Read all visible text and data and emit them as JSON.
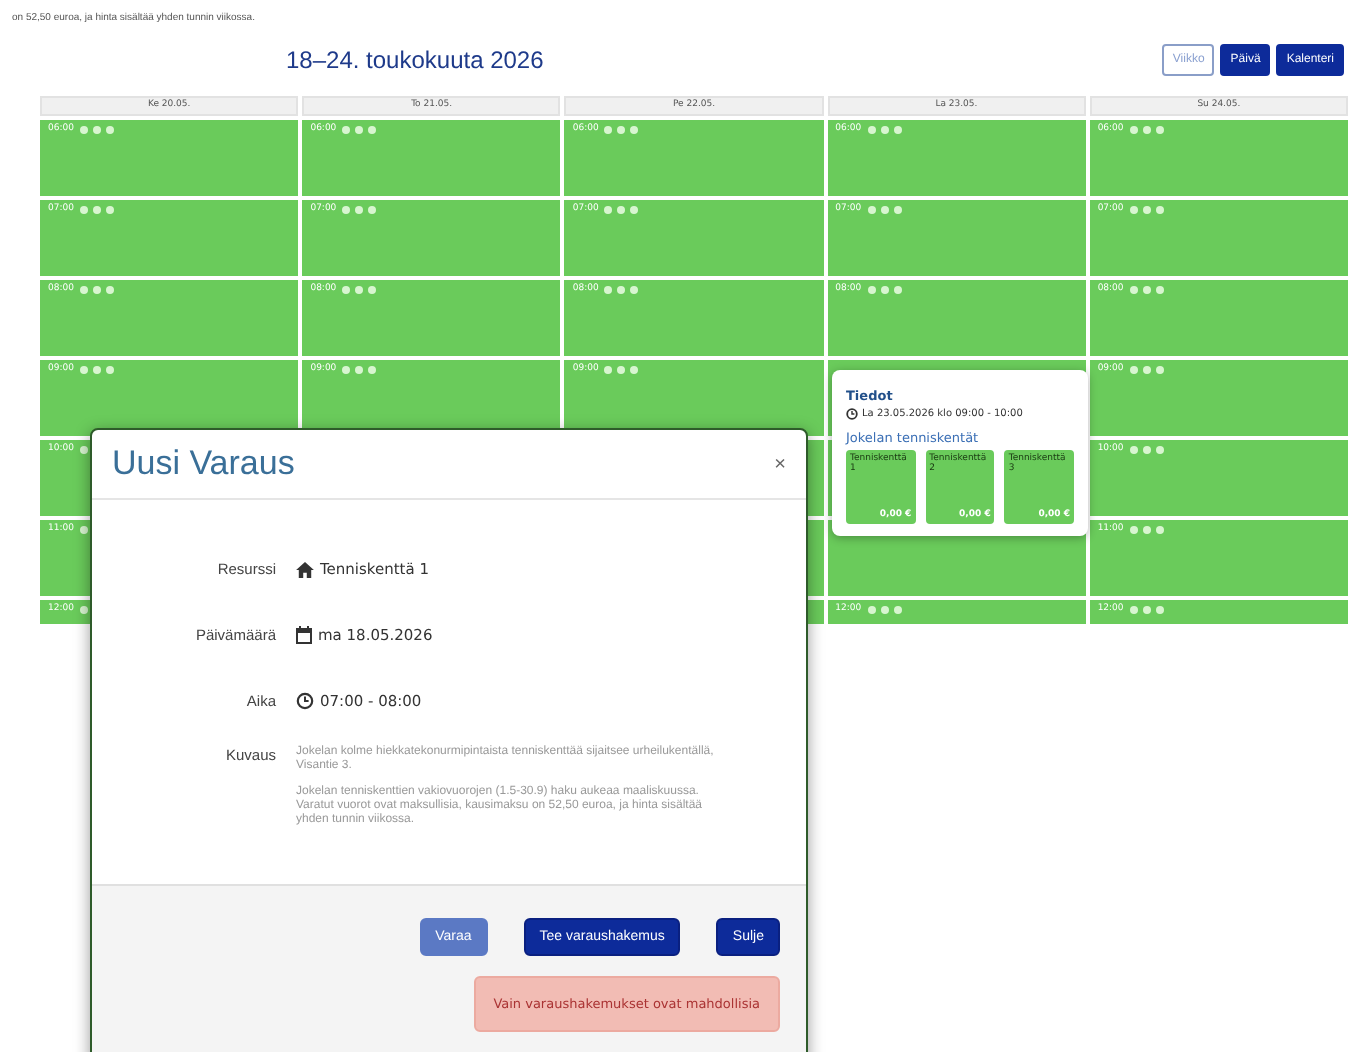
{
  "intro_text": "on 52,50 euroa, ja hinta sisältää yhden tunnin viikossa.",
  "calendar": {
    "title": "18–24. toukokuuta 2026",
    "views": [
      {
        "label": "Viikko",
        "selected": true
      },
      {
        "label": "Päivä",
        "selected": false
      },
      {
        "label": "Kalenteri",
        "selected": false
      }
    ],
    "columns": [
      {
        "day": "Ke 20.05.",
        "slots": [
          {
            "time": "06:00"
          },
          {
            "time": "07:00"
          },
          {
            "time": "08:00"
          },
          {
            "time": "09:00"
          },
          {
            "time": "10:00"
          },
          {
            "time": "11:00"
          },
          {
            "time": "12:00"
          }
        ]
      },
      {
        "day": "To 21.05.",
        "slots": [
          {
            "time": "06:00"
          },
          {
            "time": "07:00"
          },
          {
            "time": "08:00"
          },
          {
            "time": "09:00"
          }
        ]
      },
      {
        "day": "Pe 22.05.",
        "slots": [
          {
            "time": "06:00"
          },
          {
            "time": "07:00"
          },
          {
            "time": "08:00"
          },
          {
            "time": "09:00"
          },
          {
            "kind": "blank"
          },
          {
            "kind": "blank"
          },
          {
            "kind": "blank"
          }
        ]
      },
      {
        "day": "La 23.05.",
        "slots": [
          {
            "time": "06:00"
          },
          {
            "time": "07:00"
          },
          {
            "time": "08:00"
          },
          {
            "kind": "blank"
          },
          {
            "kind": "blank"
          },
          {
            "kind": "blank"
          },
          {
            "time": "12:00"
          }
        ]
      },
      {
        "day": "Su 24.05.",
        "slots": [
          {
            "time": "06:00"
          },
          {
            "time": "07:00"
          },
          {
            "time": "08:00"
          },
          {
            "time": "09:00"
          },
          {
            "time": "10:00"
          },
          {
            "time": "11:00"
          },
          {
            "time": "12:00"
          }
        ]
      }
    ]
  },
  "popover": {
    "title": "Tiedot",
    "when": "La 23.05.2026 klo 09:00 - 10:00",
    "place": "Jokelan tenniskentät",
    "courts": [
      {
        "name": "Tenniskenttä 1",
        "price": "0,00 €"
      },
      {
        "name": "Tenniskenttä 2",
        "price": "0,00 €"
      },
      {
        "name": "Tenniskenttä 3",
        "price": "0,00 €"
      }
    ]
  },
  "modal": {
    "title": "Uusi Varaus",
    "close": "×",
    "fields": [
      {
        "label": "Resurssi",
        "kind": "resource",
        "value": "Tenniskenttä 1"
      },
      {
        "label": "Päivämäärä",
        "kind": "date",
        "value": "ma 18.05.2026"
      },
      {
        "label": "Aika",
        "kind": "time",
        "value": "07:00 - 08:00"
      }
    ],
    "description": {
      "label": "Kuvaus",
      "paragraphs": [
        "Jokelan kolme hiekkatekonurmipintaista tenniskenttää sijaitsee urheilukentällä, Visantie 3.",
        "Jokelan tenniskenttien vakiovuorojen (1.5-30.9) haku aukeaa maaliskuussa. Varatut vuorot ovat maksullisia, kausimaksu on 52,50 euroa, ja hinta sisältää yhden tunnin viikossa."
      ]
    },
    "buttons": [
      {
        "label": "Varaa",
        "disabled": true
      },
      {
        "label": "Tee varaushakemus",
        "disabled": false
      },
      {
        "label": "Sulje",
        "disabled": false
      }
    ],
    "alert": "Vain varaushakemukset ovat mahdollisia"
  }
}
